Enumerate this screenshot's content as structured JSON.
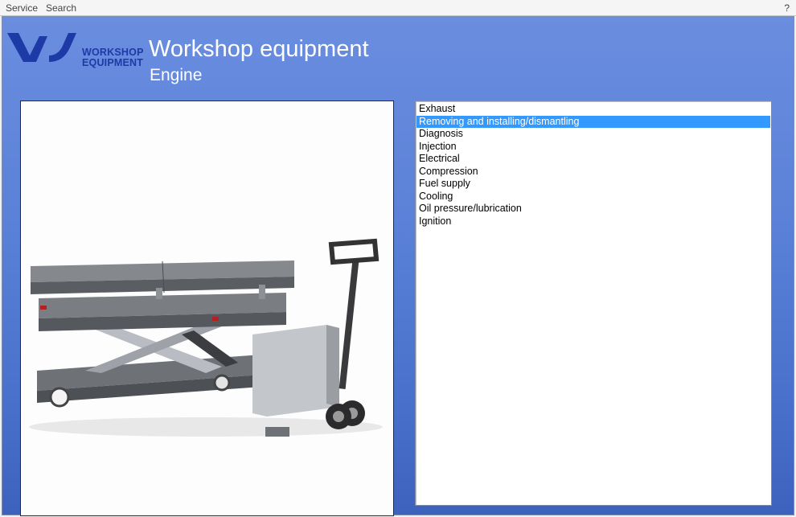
{
  "menubar": {
    "items": [
      "Service",
      "Search"
    ],
    "help": "?"
  },
  "brand": {
    "logo_line1": "WORKSHOP",
    "logo_line2": "EQUIPMENT",
    "logo_color": "#1e3aa6"
  },
  "header": {
    "title": "Workshop equipment",
    "subtitle": "Engine"
  },
  "image": {
    "subject": "mobile scissor lift table / engine lift cart"
  },
  "list": {
    "selected_index": 1,
    "selection_color": "#3399ff",
    "items": [
      "Exhaust",
      "Removing and installing/dismantling",
      "Diagnosis",
      "Injection",
      "Electrical",
      "Compression",
      "Fuel supply",
      "Cooling",
      "Oil pressure/lubrication",
      "Ignition"
    ]
  }
}
